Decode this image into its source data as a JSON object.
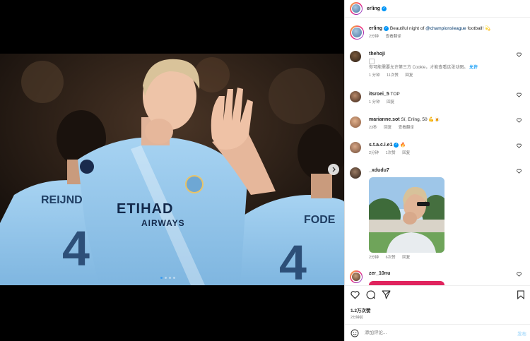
{
  "post": {
    "author": "erling",
    "caption_text": "Beautiful night of",
    "caption_mention": "@championsleague",
    "caption_end": "football!",
    "caption_emoji": "💫",
    "caption_time": "2分钟",
    "see_translation": "查看翻译",
    "image": {
      "jersey_sponsor_line1": "ETIHAD",
      "jersey_sponsor_line2": "AIRWAYS",
      "bg_player_left": "REIJND",
      "bg_player_left_number": "4",
      "bg_player_right": "FODE",
      "bg_player_right_number": "4",
      "carousel_count": 4,
      "carousel_active": 0
    },
    "likes": "1.2万次赞",
    "posted_ago": "2分钟前"
  },
  "comments": [
    {
      "user": "thehoji",
      "verified": false,
      "text": "",
      "image_alt": "",
      "notice": "你可能需要允许第三方 Cookie，才能查看这张动图。",
      "notice_action": "允许",
      "time": "1 分钟",
      "likes": "11次赞",
      "reply": "回复"
    },
    {
      "user": "itsroei_5",
      "verified": false,
      "text": "TOP",
      "time": "1 分钟",
      "reply": "回复"
    },
    {
      "user": "marianne.sot",
      "verified": false,
      "text": "Sí, Erling, 50",
      "emoji": "💪🍺",
      "time": "23秒",
      "reply": "回复",
      "see_translation": "查看翻译"
    },
    {
      "user": "s.t.a.c.i.e1",
      "verified": true,
      "text": "",
      "emoji": "🔥",
      "time": "2分钟",
      "likes": "1次赞",
      "reply": "回复"
    },
    {
      "user": "_xdudu7",
      "verified": false,
      "text": "",
      "time": "2分钟",
      "likes": "6次赞",
      "reply": "回复"
    },
    {
      "user": "zer_10nu",
      "verified": false,
      "text": ""
    }
  ],
  "comment_box": {
    "placeholder": "添加评论...",
    "post_label": "发布"
  },
  "colors": {
    "accent": "#0095f6",
    "link": "#00376b",
    "muted": "#737373",
    "text": "#262626",
    "jersey": "#8fc3ea"
  },
  "icons": [
    "heart-icon",
    "comment-icon",
    "share-icon",
    "bookmark-icon",
    "emoji-icon",
    "chevron-right-icon",
    "verified-icon"
  ]
}
